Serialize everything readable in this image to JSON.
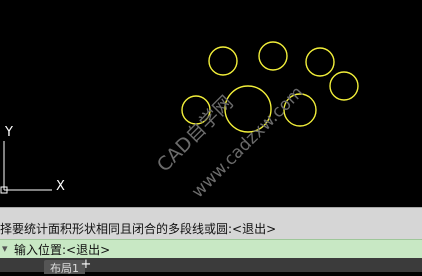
{
  "watermark": {
    "line1": "CAD自学网",
    "line2": "www.cadzxw.com"
  },
  "ucs": {
    "x_label": "X",
    "y_label": "Y"
  },
  "command_history": "择要统计面积形状相同且闭合的多段线或圆:<退出>",
  "command_line": {
    "prefix_icon": "command-dropdown-icon",
    "prompt": "输入位置:<退出>"
  },
  "tabs": [
    {
      "label": "布局1"
    }
  ],
  "add_tab_label": "+",
  "colors": {
    "circle": "#f2ef3a",
    "background": "#000000",
    "ucs": "#ffffff"
  }
}
